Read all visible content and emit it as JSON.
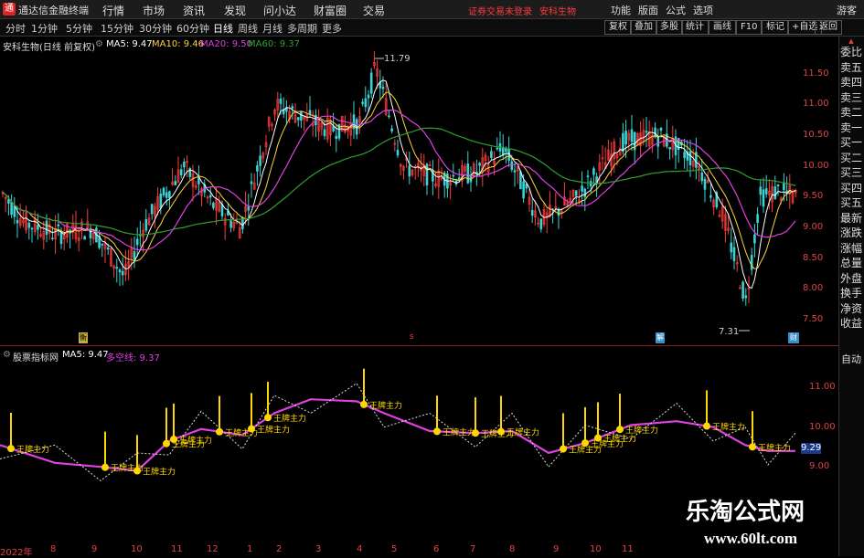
{
  "app_title": "通达信金融终端",
  "menu": [
    "行情",
    "市场",
    "资讯",
    "发现",
    "问小达",
    "财富圈",
    "交易"
  ],
  "warning": "证券交易未登录",
  "stock_link": "安科生物",
  "right_menu": [
    "功能",
    "版面",
    "公式",
    "选项"
  ],
  "guest": "游客",
  "periods": [
    "分时",
    "1分钟",
    "5分钟",
    "15分钟",
    "30分钟",
    "60分钟",
    "日线",
    "周线",
    "月线",
    "多周期",
    "更多"
  ],
  "active_period": "日线",
  "tools": [
    "复权",
    "叠加",
    "多股",
    "统计",
    "画线",
    "F10",
    "标记",
    "+自选",
    "返回"
  ],
  "chart_info": {
    "title": "安科生物(日线 前复权)",
    "ma5": "MA5: 9.47",
    "ma10": "MA10: 9.46",
    "ma20": "MA20: 9.50",
    "ma60": "MA60: 9.37"
  },
  "price_axis": [
    "11.50",
    "11.00",
    "10.50",
    "10.00",
    "9.50",
    "9.00",
    "8.50",
    "8.00",
    "7.50"
  ],
  "high_label": "11.79",
  "low_label": "7.31",
  "markers": [
    "衡",
    "s",
    "解",
    "财"
  ],
  "indicator": {
    "title": "股票指标网",
    "ma5": "MA5: 9.47",
    "duokong": "多空线: 9.37",
    "current": "9.29"
  },
  "sub_axis": [
    "11.00",
    "10.00",
    "9.00"
  ],
  "signal_label": "王牌主力",
  "x_axis": [
    "2022年",
    "8",
    "9",
    "10",
    "11",
    "12",
    "1",
    "2",
    "3",
    "4",
    "5",
    "6",
    "7",
    "8",
    "9",
    "10",
    "11"
  ],
  "right_column": [
    "委比",
    "卖五",
    "卖四",
    "卖三",
    "卖二",
    "卖一",
    "买一",
    "买二",
    "买三",
    "买四",
    "买五",
    "最新",
    "涨跌",
    "涨幅",
    "总量",
    "外盘",
    "换手",
    "净资",
    "收益",
    "自动"
  ],
  "watermark_cn": "乐淘公式网",
  "watermark_url": "www.60lt.com",
  "colors": {
    "up": "#ff3b3b",
    "down": "#3ad3d3",
    "ma5": "#ffffff",
    "ma10": "#ffd23f",
    "ma20": "#e040e0",
    "ma60": "#2ea02e",
    "duokong": "#e040e0"
  }
}
